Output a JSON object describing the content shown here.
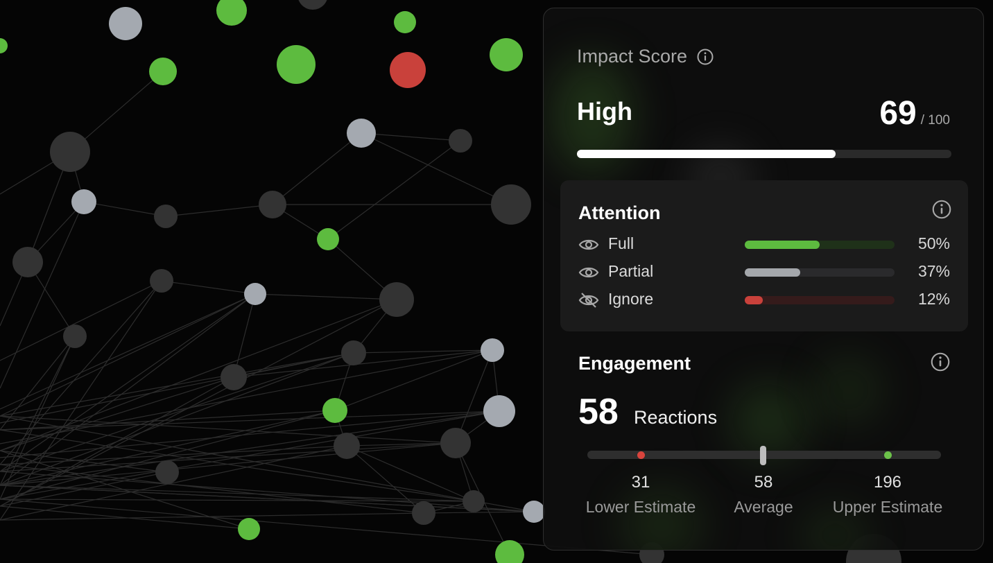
{
  "impact": {
    "title": "Impact Score",
    "level": "High",
    "score": "69",
    "score_max": "/ 100",
    "score_fraction": 0.69
  },
  "attention": {
    "title": "Attention",
    "rows": [
      {
        "label": "Full",
        "value": "50%",
        "fraction": 0.5,
        "color": "#5dbb3f",
        "track": "#1f3119",
        "icon": "eye-icon"
      },
      {
        "label": "Partial",
        "value": "37%",
        "fraction": 0.37,
        "color": "#a4a7ab",
        "track": "#2a2a2c",
        "icon": "eye-icon"
      },
      {
        "label": "Ignore",
        "value": "12%",
        "fraction": 0.12,
        "color": "#c9413b",
        "track": "#351b1b",
        "icon": "eye-off-icon"
      }
    ]
  },
  "engagement": {
    "title": "Engagement",
    "value": "58",
    "unit": "Reactions",
    "lower": {
      "value": "31",
      "label": "Lower Estimate"
    },
    "average": {
      "value": "58",
      "label": "Average"
    },
    "upper": {
      "value": "196",
      "label": "Upper Estimate"
    }
  },
  "colors": {
    "green": "#5dbb3f",
    "red": "#c9413b",
    "light_gray": "#a4a9b0",
    "dark_gray": "#333333",
    "mid_gray": "#4a4a4a",
    "panel_bg": "#0e0e0e"
  }
}
